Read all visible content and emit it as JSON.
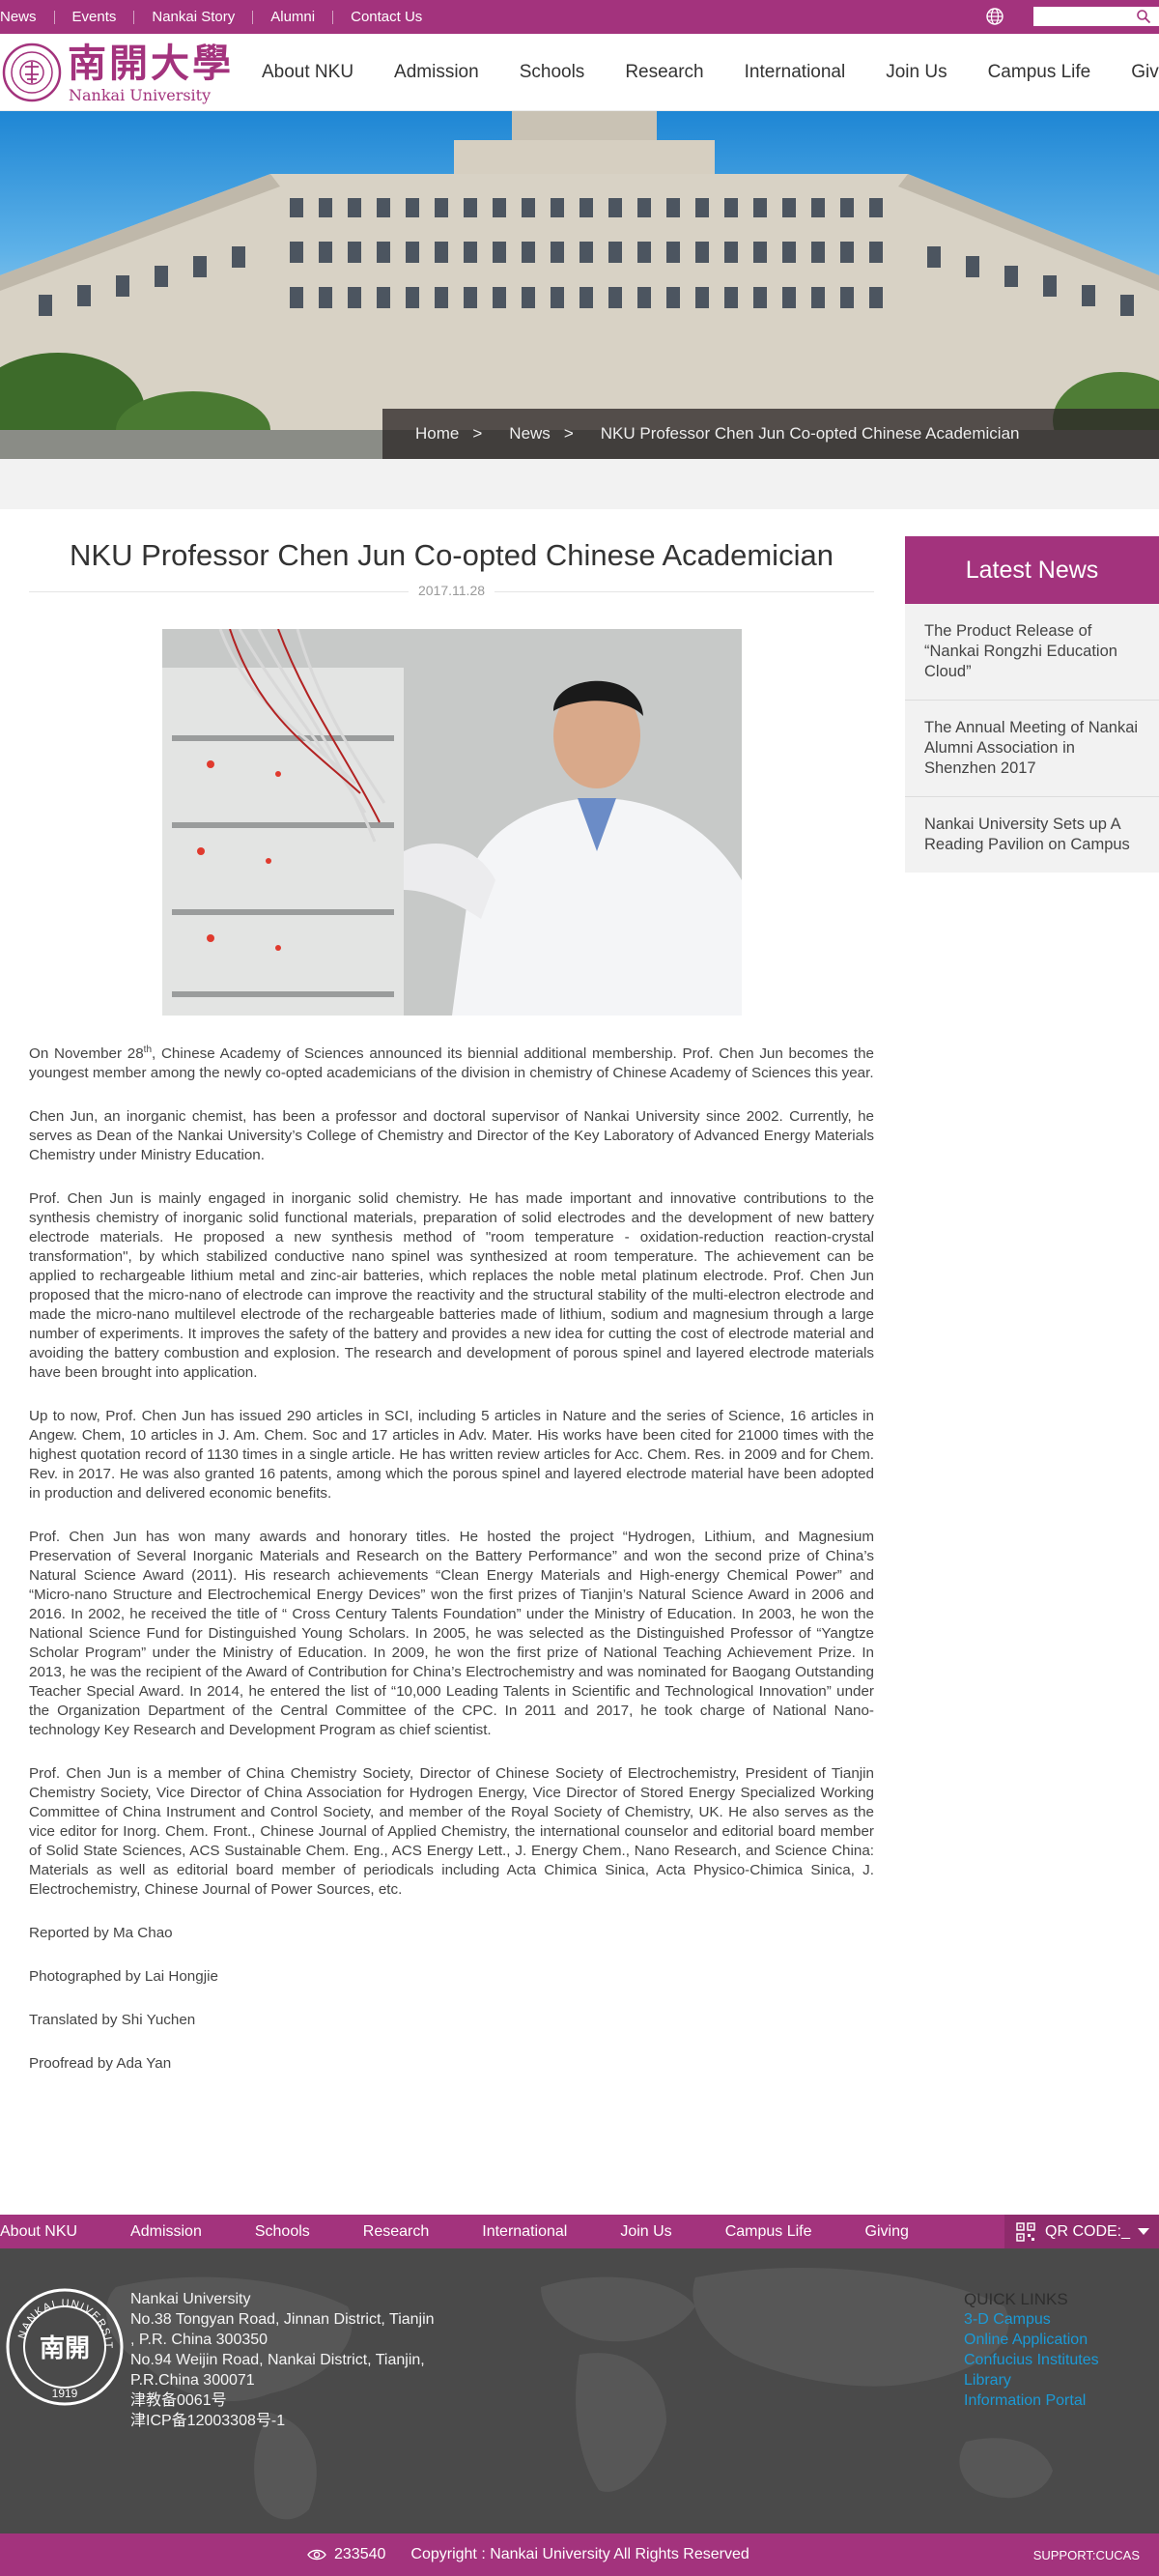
{
  "topbar": {
    "links": [
      "News",
      "Events",
      "Nankai Story",
      "Alumni",
      "Contact Us"
    ],
    "globe_icon": "globe-icon",
    "search_icon": "search-icon",
    "search_placeholder": ""
  },
  "header": {
    "logo_cn": "南開大學",
    "logo_en": "Nankai University",
    "nav": [
      "About NKU",
      "Admission",
      "Schools",
      "Research",
      "International",
      "Join Us",
      "Campus Life",
      "Giving"
    ]
  },
  "breadcrumb": {
    "home": "Home",
    "sep": ">",
    "section": "News",
    "current": "NKU Professor Chen Jun Co-opted Chinese Academician"
  },
  "article": {
    "title": "NKU Professor Chen Jun Co-opted Chinese Academician",
    "date": "2017.11.28",
    "p1_before": "On November 28",
    "p1_sup": "th",
    "p1_after": ", Chinese Academy of Sciences announced its biennial additional membership. Prof. Chen Jun becomes the youngest member among the newly co-opted academicians of the division in chemistry of Chinese Academy of Sciences this year.",
    "p2": "Chen Jun, an inorganic chemist, has been a professor and doctoral supervisor of Nankai University since 2002. Currently, he serves as Dean of the Nankai University’s College of Chemistry and Director of the Key Laboratory of Advanced Energy Materials Chemistry under Ministry Education.",
    "p3": "Prof. Chen Jun is mainly engaged in inorganic solid chemistry. He has made important and innovative contributions to the synthesis chemistry of inorganic solid functional materials, preparation of solid electrodes and the development of new battery electrode materials. He proposed a new synthesis method of \"room temperature - oxidation-reduction reaction-crystal transformation\", by which stabilized conductive nano spinel was synthesized at room temperature. The achievement can be applied to rechargeable lithium metal and zinc-air batteries, which replaces the noble metal platinum electrode. Prof. Chen Jun proposed that the micro-nano of electrode can improve the reactivity and the structural stability of the multi-electron electrode and made the micro-nano multilevel electrode of the rechargeable batteries made of lithium, sodium and magnesium through a large number of experiments. It improves the safety of the battery and provides a new idea for cutting the cost of electrode material and avoiding the battery combustion and explosion. The research and development of porous spinel and layered electrode materials have been brought into application.",
    "p4": "Up to now, Prof. Chen Jun has issued 290 articles in SCI, including 5 articles in Nature and the series of Science, 16 articles in Angew. Chem, 10 articles in J. Am. Chem. Soc and 17 articles in Adv. Mater. His works have been cited for 21000 times with the highest quotation record of 1130 times in a single article. He has written review articles for Acc. Chem. Res. in 2009 and for Chem. Rev. in 2017. He was also granted 16 patents, among which the porous spinel and layered electrode material have been adopted in production and delivered economic benefits.",
    "p5": "Prof. Chen Jun has won many awards and honorary titles. He hosted the project “Hydrogen, Lithium, and Magnesium Preservation of Several Inorganic Materials and Research on the Battery Performance” and won the second prize of China’s Natural Science Award (2011). His research achievements “Clean Energy Materials and High-energy Chemical Power” and “Micro-nano Structure and Electrochemical Energy Devices” won the first prizes of Tianjin’s Natural Science Award in 2006 and 2016. In 2002, he received the title of “ Cross Century Talents Foundation” under the Ministry of Education. In 2003, he won the National Science Fund for Distinguished Young Scholars. In 2005, he was selected as the Distinguished Professor of “Yangtze Scholar Program” under the Ministry of Education. In 2009, he won the first prize of National Teaching Achievement Prize. In 2013, he was the recipient of the Award of Contribution for China’s Electrochemistry and was nominated for Baogang Outstanding Teacher Special Award. In 2014, he entered the list of “10,000 Leading Talents in Scientific and Technological Innovation” under the Organization Department of the Central Committee of the CPC. In 2011 and 2017, he took charge of National Nano-technology Key Research and Development Program as chief scientist.",
    "p6": "Prof. Chen Jun is a member of China Chemistry Society, Director of Chinese Society of Electrochemistry, President of Tianjin Chemistry Society, Vice Director of China Association for Hydrogen Energy, Vice Director of Stored Energy Specialized Working Committee of China Instrument and Control Society, and member of the Royal Society of Chemistry, UK. He also serves as the vice editor for Inorg. Chem. Front., Chinese Journal of Applied Chemistry, the international counselor and editorial board member of Solid State Sciences, ACS Sustainable Chem. Eng., ACS Energy Lett., J. Energy Chem., Nano Research, and Science China: Materials as well as editorial board member of periodicals including Acta Chimica Sinica, Acta Physico-Chimica Sinica, J. Electrochemistry, Chinese Journal of Power Sources, etc.",
    "reported": "Reported by Ma Chao",
    "photographed": "Photographed by Lai Hongjie",
    "translated": "Translated by Shi Yuchen",
    "proofread": "Proofread by Ada Yan"
  },
  "sidebar": {
    "title": "Latest News",
    "items": [
      "The Product Release of “Nankai Rongzhi Education Cloud”",
      "The Annual Meeting of Nankai Alumni Association in Shenzhen 2017",
      "Nankai University Sets up A Reading Pavilion on Campus"
    ]
  },
  "footer": {
    "nav": [
      "About NKU",
      "Admission",
      "Schools",
      "Research",
      "International",
      "Join Us",
      "Campus Life",
      "Giving"
    ],
    "qr_label": "QR CODE:_",
    "qr_icon": "qr-code-icon",
    "emblem_text_top": "NANKAI UNIVERSITY",
    "emblem_year": "1919",
    "emblem_cn": "南開",
    "address_lines": [
      "Nankai University",
      "No.38 Tongyan Road, Jinnan District, Tianjin",
      ", P.R. China 300350",
      "No.94 Weijin Road,  Nankai District, Tianjin,",
      "P.R.China  300071",
      "津教备0061号",
      "津ICP备12003308号-1"
    ],
    "quick_links_title": "QUICK LINKS",
    "quick_links": [
      "3-D Campus",
      "Online Application",
      "Confucius Institutes",
      "Library",
      "Information Portal"
    ],
    "visit_count": "233540",
    "copyright": "Copyright : Nankai University All Rights Reserved",
    "support": "SUPPORT:CUCAS",
    "eye_icon": "eye-icon"
  },
  "colors": {
    "brand": "#a3337d",
    "footer_dark": "#4a4a4a",
    "link_blue": "#1b9ad6"
  }
}
